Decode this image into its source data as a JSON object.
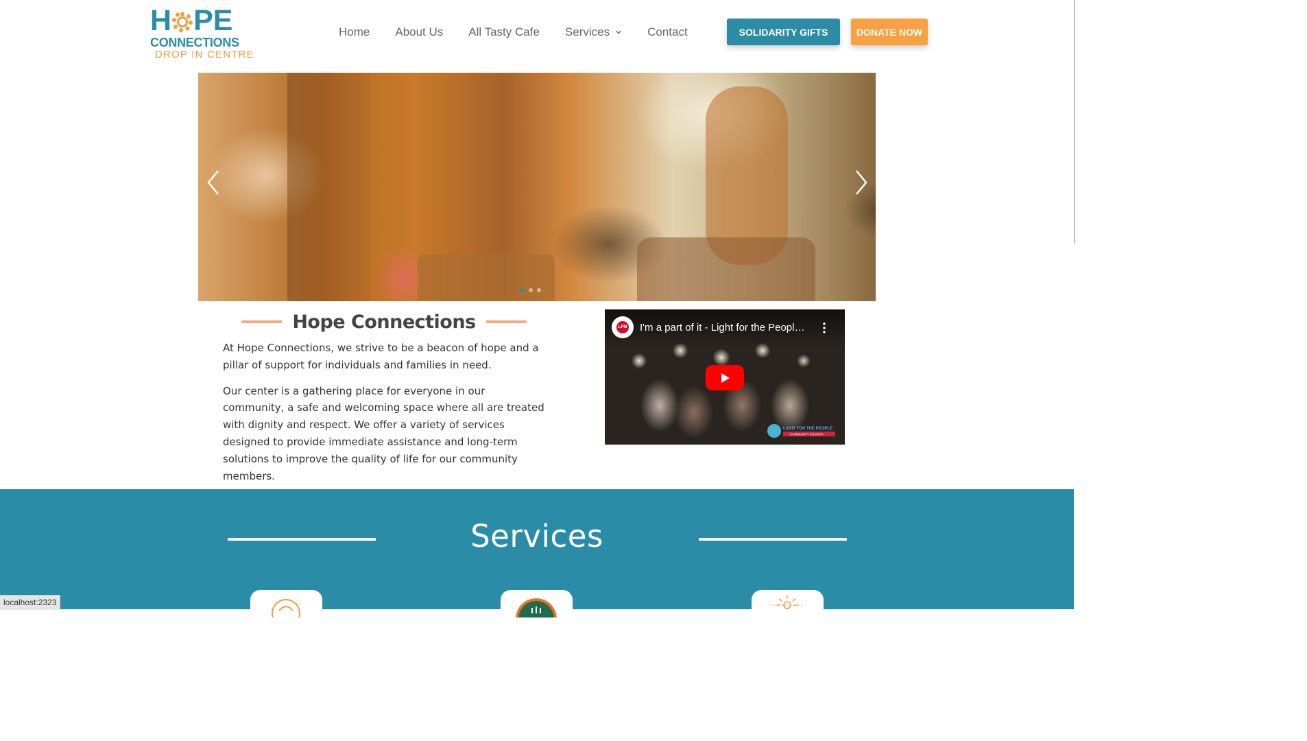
{
  "brand": {
    "logo_line1": "HOPE",
    "logo_line2": "CONNECTIONS",
    "logo_line3": "DROP IN CENTRE",
    "primary_color": "#2b8ca8",
    "accent_color": "#f7a142"
  },
  "nav": {
    "items": [
      {
        "label": "Home"
      },
      {
        "label": "About Us"
      },
      {
        "label": "All Tasty Cafe"
      },
      {
        "label": "Services",
        "icon": "chevron-down-icon"
      },
      {
        "label": "Contact"
      }
    ]
  },
  "header_buttons": {
    "solidarity": "SOLIDARITY GIFTS",
    "donate": "DONATE NOW"
  },
  "hero": {
    "prev_icon": "chevron-left-icon",
    "next_icon": "chevron-right-icon",
    "slides": 3,
    "active_slide": 1
  },
  "intro": {
    "heading": "Hope Connections",
    "paragraph1": "At Hope Connections, we strive to be a beacon of hope and a pillar of support for individuals and families in need.",
    "paragraph2": "Our center is a gathering place for everyone in our community, a safe and welcoming space where all are treated with dignity and respect. We offer a variety of services designed to provide immediate assistance and long-term solutions to improve the quality of life for our community members."
  },
  "video": {
    "title": "I'm a part of it - Light for the People ...",
    "channel_logo": "LPM",
    "watermark_line1": "LIGHT FOR THE PEOPLE",
    "watermark_line2": "COMMUNITY CHURCH",
    "play_icon": "play-icon",
    "menu_icon": "more-vert-icon"
  },
  "services": {
    "heading": "Services"
  },
  "statusbar": {
    "url": "localhost:2323"
  }
}
